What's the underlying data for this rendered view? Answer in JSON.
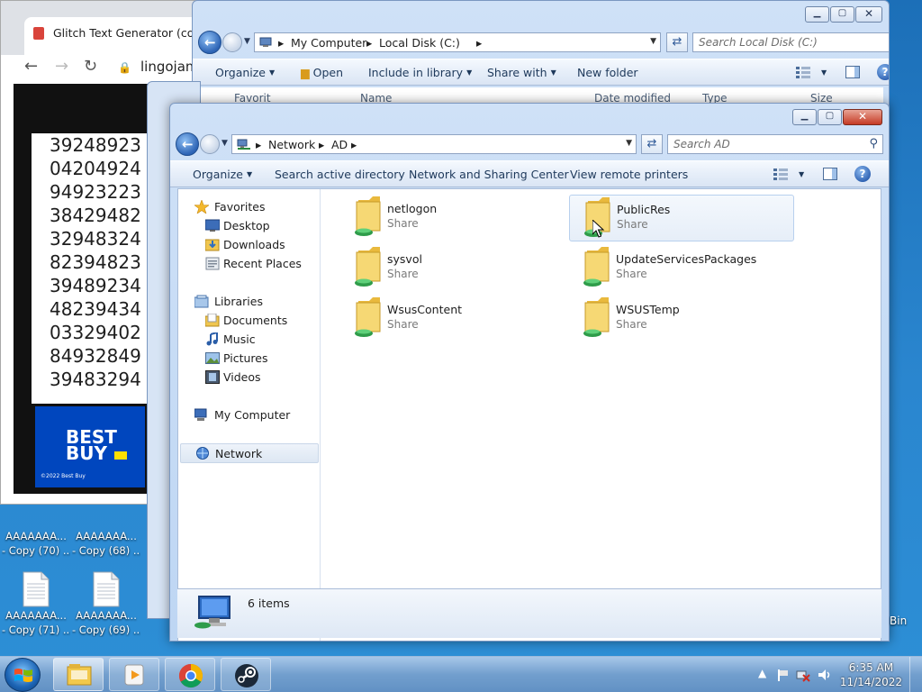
{
  "chrome": {
    "tab_title": "Glitch Text Generator (copy ar",
    "url": "lingojam.",
    "digits": [
      "39248923",
      "04204924",
      "94923223",
      "38429482",
      "32948324",
      "82394823",
      "39489234",
      "48239434",
      "03329402",
      "84932849",
      "39483294"
    ],
    "ad_logo_line1": "BEST",
    "ad_logo_line2": "BUY",
    "ad_copyright": "©2022 Best Buy"
  },
  "explorer_back": {
    "breadcrumb": [
      "My Computer",
      "Local Disk (C:)"
    ],
    "search_placeholder": "Search Local Disk (C:)",
    "commands": [
      "Organize",
      "Open",
      "Include in library",
      "Share with",
      "New folder"
    ],
    "columns": [
      "Name",
      "Date modified",
      "Type",
      "Size"
    ],
    "nav_first": "Favorit"
  },
  "explorer_front": {
    "breadcrumb": [
      "Network",
      "AD"
    ],
    "search_placeholder": "Search AD",
    "commands": [
      "Organize",
      "Search active directory",
      "Network and Sharing Center",
      "View remote printers"
    ],
    "nav": {
      "favorites": "Favorites",
      "desktop": "Desktop",
      "downloads": "Downloads",
      "recent": "Recent Places",
      "libraries": "Libraries",
      "documents": "Documents",
      "music": "Music",
      "pictures": "Pictures",
      "videos": "Videos",
      "computer": "My Computer",
      "network": "Network"
    },
    "items": [
      {
        "name": "netlogon",
        "type": "Share"
      },
      {
        "name": "PublicRes",
        "type": "Share"
      },
      {
        "name": "sysvol",
        "type": "Share"
      },
      {
        "name": "UpdateServicesPackages",
        "type": "Share"
      },
      {
        "name": "WsusContent",
        "type": "Share"
      },
      {
        "name": "WSUSTemp",
        "type": "Share"
      }
    ],
    "status_count": "6 items"
  },
  "desktop": {
    "icons": [
      {
        "line1": "AAAAAAA...",
        "line2": "- Copy (70) ..."
      },
      {
        "line1": "AAAAAAA...",
        "line2": "- Copy (68) ..."
      },
      {
        "line1": "AAAAAAA...",
        "line2": "- Copy (71) ..."
      },
      {
        "line1": "AAAAAAA...",
        "line2": "- Copy (69) ..."
      }
    ],
    "recycle_bin_partial": "Bin"
  },
  "taskbar": {
    "time": "6:35 AM",
    "date": "11/14/2022"
  },
  "colors": {
    "desktop": "#2a86cf",
    "explorer_frame": "#bed6f3",
    "close_red": "#c53a24",
    "folder_yellow": "#f4d36a"
  }
}
